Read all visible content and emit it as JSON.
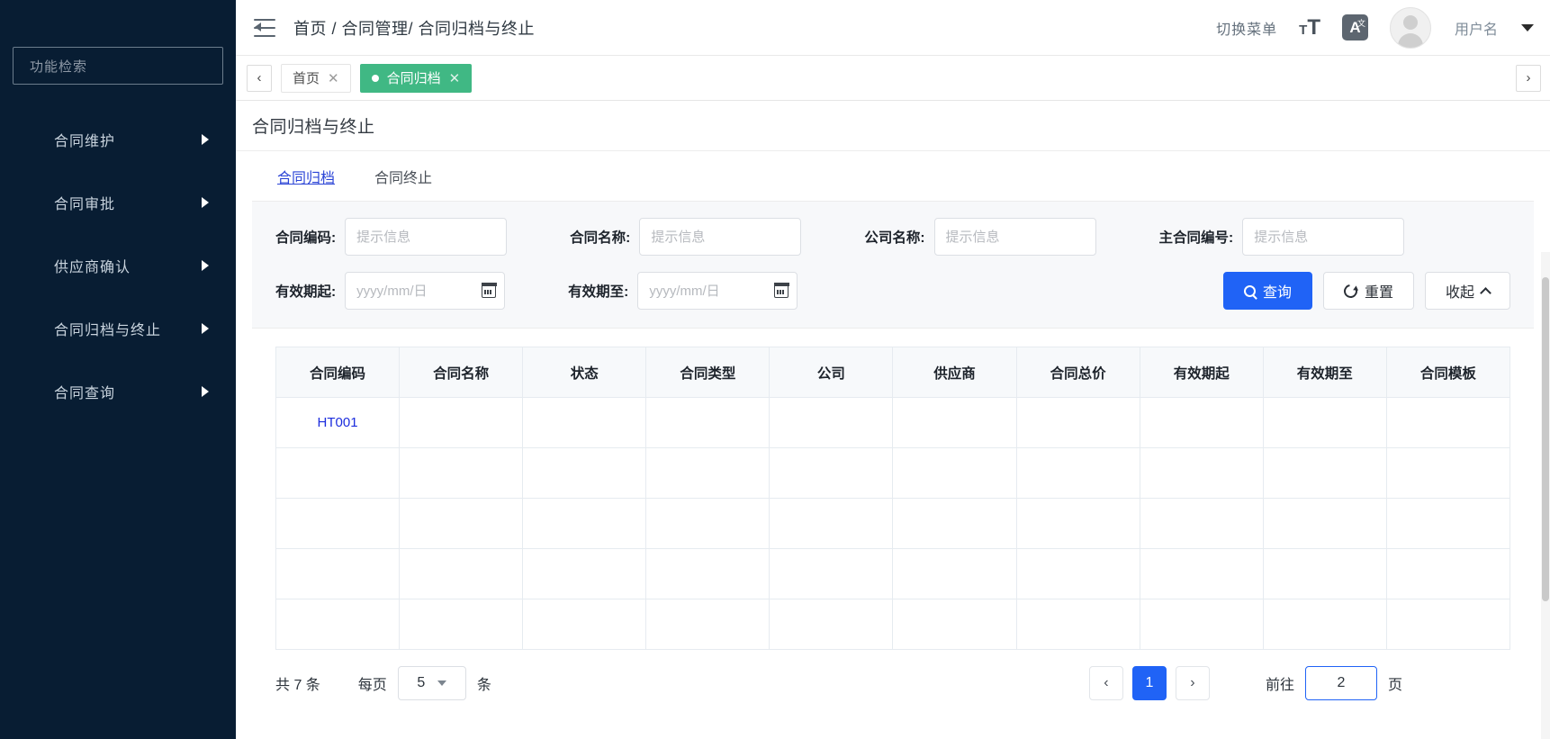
{
  "sidebar": {
    "search_placeholder": "功能检索",
    "items": [
      {
        "label": "合同维护"
      },
      {
        "label": "合同审批"
      },
      {
        "label": "供应商确认"
      },
      {
        "label": "合同归档与终止"
      },
      {
        "label": "合同查询"
      }
    ]
  },
  "header": {
    "breadcrumb": "首页 / 合同管理/ 合同归档与终止",
    "switch_menu": "切换菜单",
    "lang_letter": "A",
    "lang_sup": "文",
    "username": "用户名"
  },
  "tabbar": {
    "prev": "‹",
    "next": "›",
    "tabs": [
      {
        "label": "首页",
        "close": "✕",
        "active": false
      },
      {
        "label": "合同归档",
        "close": "✕",
        "active": true
      }
    ]
  },
  "page": {
    "title": "合同归档与终止",
    "subtabs": [
      {
        "label": "合同归档",
        "active": true
      },
      {
        "label": "合同终止",
        "active": false
      }
    ]
  },
  "search_form": {
    "fields": [
      {
        "label": "合同编码:",
        "value": "",
        "placeholder": "提示信息"
      },
      {
        "label": "合同名称:",
        "value": "",
        "placeholder": "提示信息"
      },
      {
        "label": "公司名称:",
        "value": "",
        "placeholder": "提示信息"
      },
      {
        "label": "主合同编号:",
        "value": "",
        "placeholder": "提示信息"
      },
      {
        "label": "有效期起:",
        "value": "",
        "placeholder": "yyyy/mm/日"
      },
      {
        "label": "有效期至:",
        "value": "",
        "placeholder": "yyyy/mm/日"
      }
    ],
    "buttons": {
      "query": "查询",
      "reset": "重置",
      "collapse": "收起"
    }
  },
  "table": {
    "columns": [
      "合同编码",
      "合同名称",
      "状态",
      "合同类型",
      "公司",
      "供应商",
      "合同总价",
      "有效期起",
      "有效期至",
      "合同模板"
    ],
    "rows": [
      [
        "HT001",
        "",
        "",
        "",
        "",
        "",
        "",
        "",
        "",
        ""
      ],
      [
        "",
        "",
        "",
        "",
        "",
        "",
        "",
        "",
        "",
        ""
      ],
      [
        "",
        "",
        "",
        "",
        "",
        "",
        "",
        "",
        "",
        ""
      ],
      [
        "",
        "",
        "",
        "",
        "",
        "",
        "",
        "",
        "",
        ""
      ],
      [
        "",
        "",
        "",
        "",
        "",
        "",
        "",
        "",
        "",
        ""
      ]
    ]
  },
  "pagination": {
    "total_text": "共 7 条",
    "per_page_label": "每页",
    "per_page_value": "5",
    "per_page_unit": "条",
    "prev": "‹",
    "current_page": "1",
    "next": "›",
    "goto_label": "前往",
    "goto_value": "2",
    "goto_unit": "页"
  },
  "colors": {
    "sidebar_bg": "#081d33",
    "tab_active": "#40b884",
    "primary": "#2063f6",
    "link": "#1c2ddd"
  }
}
